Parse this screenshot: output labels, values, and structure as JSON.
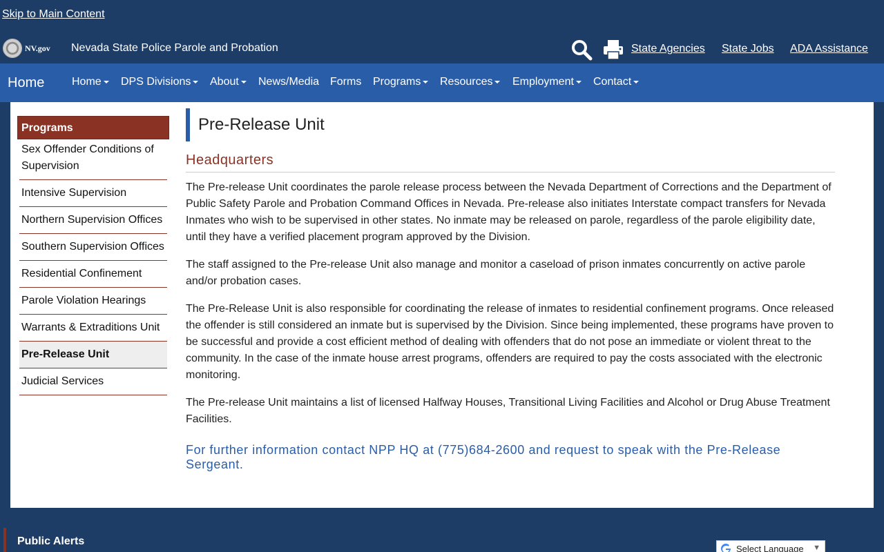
{
  "skip_link": "Skip to Main Content",
  "header": {
    "nvgov": "NV.gov",
    "agency": "Nevada State Police Parole and Probation",
    "links": [
      "State Agencies",
      "State Jobs",
      "ADA Assistance"
    ]
  },
  "nav": {
    "brand": "Home",
    "items": [
      "Home",
      "DPS Divisions",
      "About",
      "News/Media",
      "Forms",
      "Programs",
      "Resources",
      "Employment",
      "Contact"
    ]
  },
  "sidebar": {
    "heading": "Programs",
    "items": [
      "Sex Offender Conditions of Supervision",
      "Intensive Supervision",
      "Northern Supervision Offices",
      "Southern Supervision Offices",
      "Residential Confinement",
      "Parole Violation Hearings",
      "Warrants & Extraditions Unit",
      "Pre-Release Unit",
      "Judicial Services"
    ],
    "active": "Pre-Release Unit"
  },
  "main": {
    "title": "Pre-Release Unit",
    "section": "Headquarters",
    "paragraphs": [
      "The Pre-release Unit coordinates the parole release process between the Nevada Department of Corrections and the Department of Public Safety Parole and Probation Command Offices in Nevada. Pre-release also initiates Interstate compact transfers for Nevada Inmates who wish to be supervised in other states. No inmate may be released on parole, regardless of the parole eligibility date, until they have a verified placement program approved by the Division.",
      "The staff assigned to the Pre-release Unit also manage and monitor a caseload of prison inmates concurrently on active parole and/or probation cases.",
      "The Pre-Release Unit is also responsible for coordinating the release of inmates to residential confinement programs. Once released the offender is still considered an inmate but is supervised by the Division. Since being implemented, these programs have proven to be successful and provide a cost efficient method of dealing with offenders that do not pose an immediate or violent threat to the community. In the case of the inmate house arrest programs, offenders are required to pay the costs associated with the electronic monitoring.",
      "The Pre-release Unit maintains a list of licensed Halfway Houses, Transitional Living Facilities and Alcohol or Drug Abuse Treatment Facilities."
    ],
    "contact_note": "For further information contact NPP HQ at (775)684-2600 and request to speak with the Pre-Release Sergeant."
  },
  "footer": {
    "public_alerts": "Public Alerts",
    "language_select": "Select Language",
    "language_arrow": "▼"
  },
  "colors": {
    "header_bg": "#1e3d66",
    "nav_bg": "#2a5da8",
    "accent": "#8a3324"
  }
}
